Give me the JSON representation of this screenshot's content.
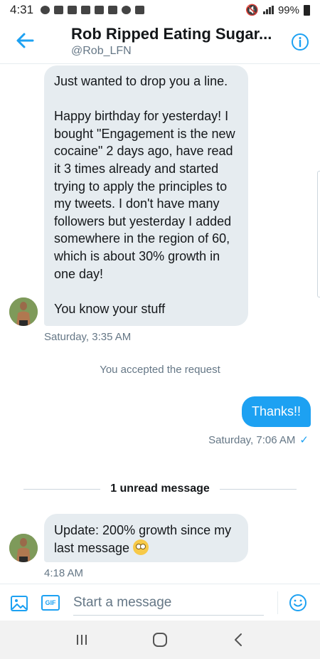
{
  "status_bar": {
    "time": "4:31",
    "battery": "99%"
  },
  "header": {
    "title": "Rob Ripped Eating Sugar...",
    "handle": "@Rob_LFN",
    "back_icon": "arrow-left-icon",
    "info_icon": "info-icon"
  },
  "conversation": {
    "messages": [
      {
        "direction": "incoming",
        "paragraphs": [
          "Just wanted to drop you a line.",
          "Happy birthday for yesterday! I bought \"Engagement is the new cocaine\" 2 days ago, have read it 3 times already and started trying to apply the principles to my tweets. I don't have many followers but yesterday I added somewhere in the region of 60, which is about 30% growth in one day!",
          "You know your stuff"
        ],
        "time": "Saturday, 3:35 AM"
      },
      {
        "direction": "system",
        "text": "You accepted the request"
      },
      {
        "direction": "outgoing",
        "text": "Thanks!!",
        "time": "Saturday, 7:06 AM",
        "status_icon": "checkmark-icon"
      },
      {
        "direction": "divider",
        "text": "1 unread message"
      },
      {
        "direction": "incoming",
        "text": "Update: 200% growth since my last message",
        "emoji": "flushed-face-emoji",
        "time": "4:18 AM"
      }
    ]
  },
  "composer": {
    "placeholder": "Start a message",
    "gif_label": "GIF",
    "image_icon": "image-icon",
    "emoji_icon": "smiley-icon"
  },
  "colors": {
    "accent": "#1da1f2",
    "bubble_incoming": "#e6ecf0",
    "secondary_text": "#657786"
  }
}
